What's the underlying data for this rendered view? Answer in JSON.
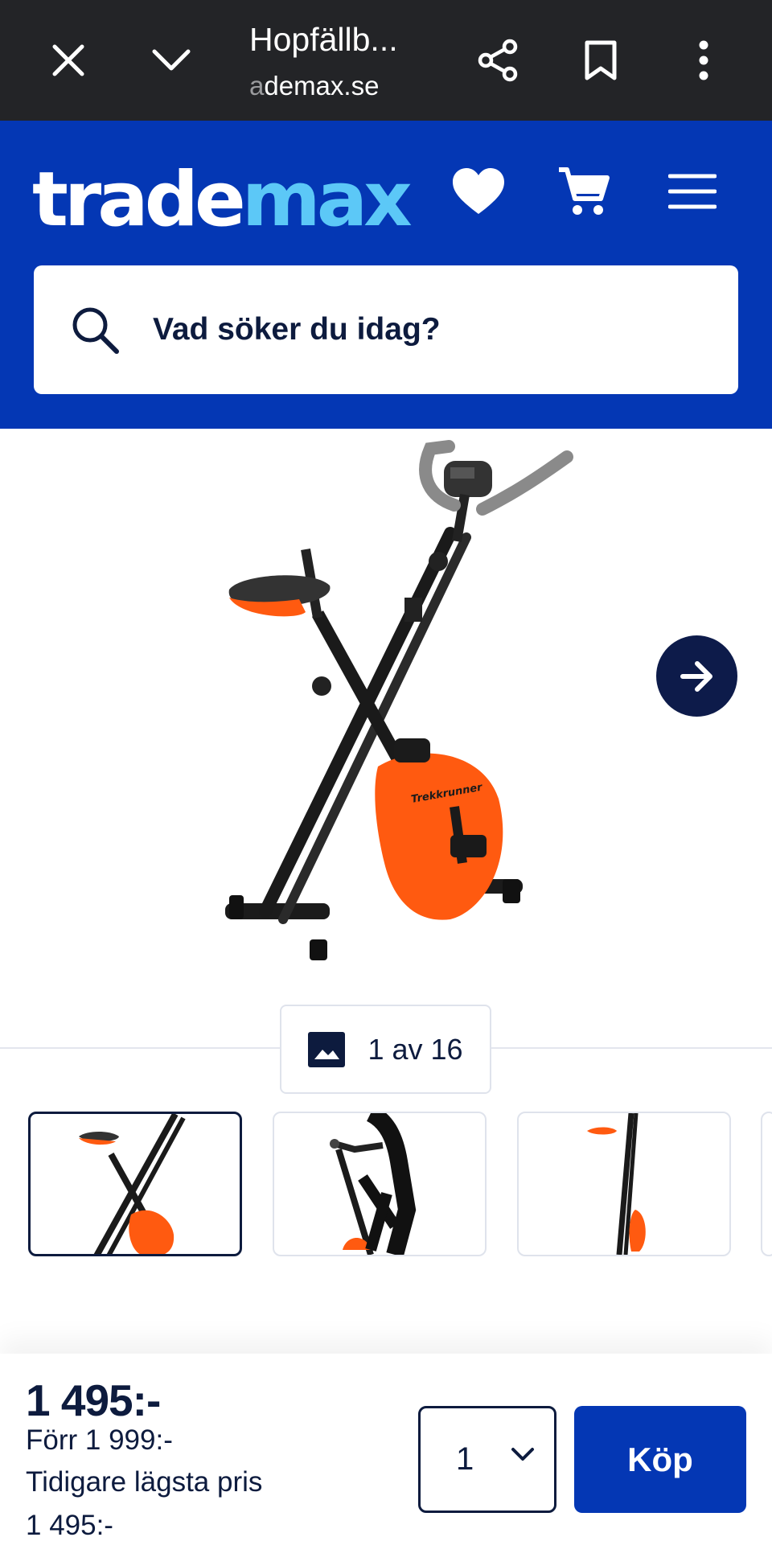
{
  "browser": {
    "tab_title": "Hopfällb...",
    "url_faded": "a",
    "url": "demax.se",
    "icons": [
      "close-icon",
      "chevron-down-icon",
      "share-icon",
      "bookmark-icon",
      "more-vert-icon"
    ]
  },
  "header": {
    "logo_part1": "trade",
    "logo_part2": "max",
    "icons": [
      "heart-icon",
      "cart-icon",
      "menu-icon"
    ],
    "colors": {
      "background": "#0437b4",
      "logo_accent": "#5cc8f7"
    }
  },
  "search": {
    "placeholder": "Vad söker du idag?"
  },
  "gallery": {
    "counter": "1 av 16",
    "product_brand": "Trekkrunner",
    "selected_thumbnail": 1
  },
  "purchase": {
    "price": "1 495:-",
    "previous_price": "Förr 1 999:-",
    "lowest_label": "Tidigare lägsta pris",
    "lowest_price": "1 495:-",
    "quantity": "1",
    "buy_label": "Köp",
    "colors": {
      "primary": "#0437b4",
      "text": "#0d1b3e"
    }
  }
}
